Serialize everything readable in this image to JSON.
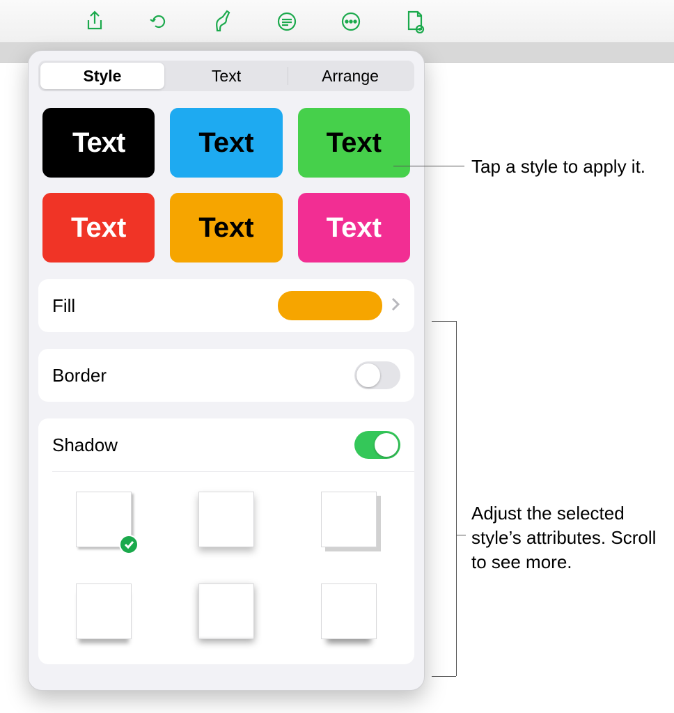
{
  "toolbar": {
    "icons": [
      "share-icon",
      "undo-icon",
      "format-brush-icon",
      "insert-icon",
      "more-icon",
      "document-icon"
    ]
  },
  "tabs": {
    "style": "Style",
    "text": "Text",
    "arrange": "Arrange"
  },
  "swatch_label": "Text",
  "rows": {
    "fill": "Fill",
    "border": "Border",
    "shadow": "Shadow"
  },
  "fill_color": "#f6a500",
  "border_on": false,
  "shadow_on": true,
  "selected_shadow_index": 0,
  "callouts": {
    "tap_style": "Tap a style to apply it.",
    "adjust": "Adjust the selected style’s attributes. Scroll to see more."
  }
}
